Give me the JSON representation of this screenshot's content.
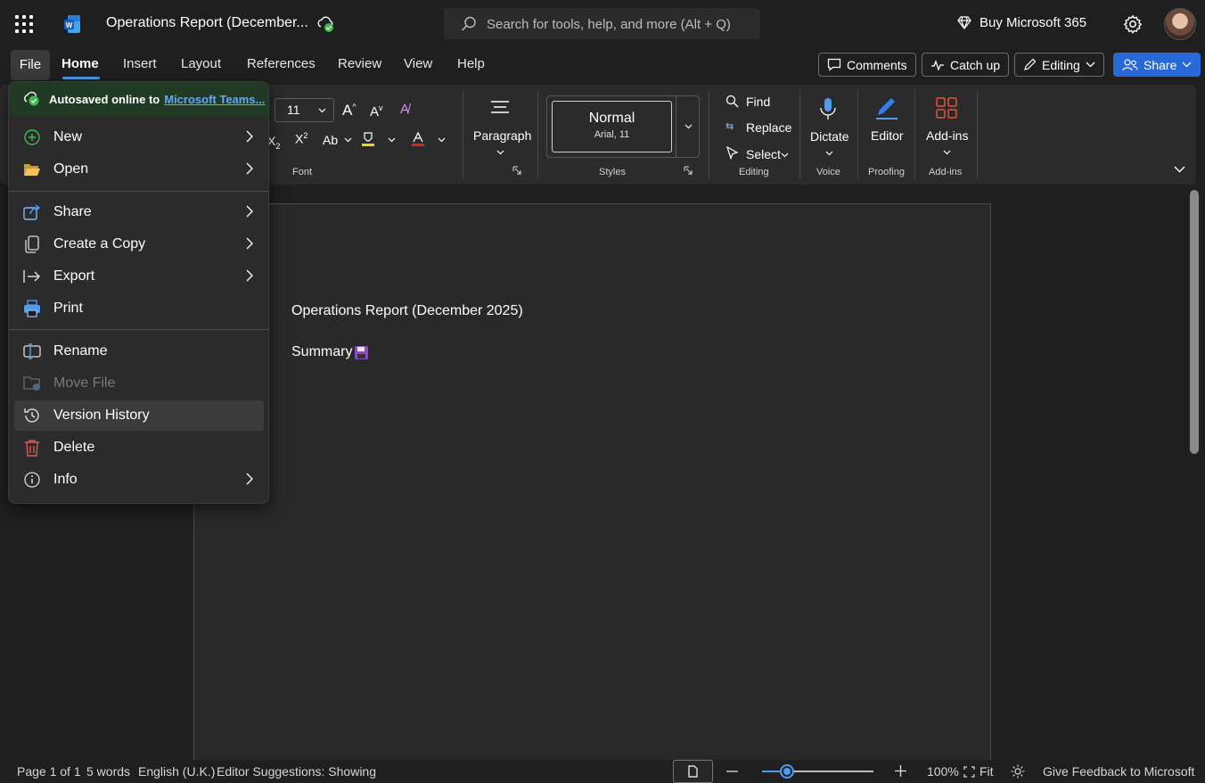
{
  "app": {
    "doc_title": "Operations Report (December...",
    "search_placeholder": "Search for tools, help, and more (Alt + Q)",
    "buy_label": "Buy Microsoft 365"
  },
  "tabs": {
    "file": "File",
    "items": [
      "Home",
      "Insert",
      "Layout",
      "References",
      "Review",
      "View",
      "Help"
    ]
  },
  "actions": {
    "comments": "Comments",
    "catchup": "Catch up",
    "editing": "Editing",
    "share": "Share"
  },
  "ribbon": {
    "font_size": "11",
    "font_group": "Font",
    "paragraph": "Paragraph",
    "style_name": "Normal",
    "style_font": "Arial, 11",
    "styles_group": "Styles",
    "find": "Find",
    "replace": "Replace",
    "select": "Select",
    "editing_group": "Editing",
    "dictate": "Dictate",
    "voice_group": "Voice",
    "editor": "Editor",
    "proofing_group": "Proofing",
    "addins": "Add-ins",
    "addins_group": "Add-ins"
  },
  "file_menu": {
    "autosave_label": "Autosaved online to",
    "autosave_link": "Microsoft Teams...",
    "items": [
      {
        "label": "New",
        "icon": "plus-circle-icon"
      },
      {
        "label": "Open",
        "icon": "folder-open-icon"
      },
      {
        "label": "Share",
        "icon": "share-icon"
      },
      {
        "label": "Create a Copy",
        "icon": "copy-icon"
      },
      {
        "label": "Export",
        "icon": "export-icon"
      },
      {
        "label": "Print",
        "icon": "printer-icon"
      },
      {
        "label": "Rename",
        "icon": "rename-icon"
      },
      {
        "label": "Move File",
        "icon": "move-file-icon"
      },
      {
        "label": "Version History",
        "icon": "history-icon"
      },
      {
        "label": "Delete",
        "icon": "trash-icon"
      },
      {
        "label": "Info",
        "icon": "info-icon"
      }
    ]
  },
  "document": {
    "line1": "Operations Report (December 2025)",
    "line2": "Summary"
  },
  "status": {
    "page": "Page 1 of 1",
    "words": "5 words",
    "language": "English (U.K.)",
    "suggestions": "Editor Suggestions: Showing",
    "zoom": "100%",
    "zoom_level": 0.22,
    "fit": "Fit",
    "feedback": "Give Feedback to Microsoft"
  },
  "colors": {
    "accent": "#4f9bf0",
    "share_button": "#2869d8",
    "autosave_bg": "#213a25",
    "delete_icon": "#e05a5a"
  }
}
